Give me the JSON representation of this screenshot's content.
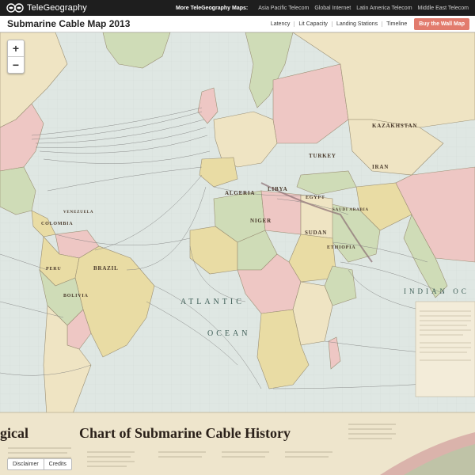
{
  "topbar": {
    "brand": "TeleGeography",
    "more_label": "More TeleGeography Maps:",
    "links": [
      "Asia Pacific Telecom",
      "Global Internet",
      "Latin America Telecom",
      "Middle East Telecom"
    ]
  },
  "titlebar": {
    "title": "Submarine Cable Map 2013",
    "nav": [
      "Latency",
      "Lit Capacity",
      "Landing Stations",
      "Timeline"
    ],
    "buy": "Buy the Wall Map"
  },
  "zoom": {
    "in": "+",
    "out": "−"
  },
  "map": {
    "oceans": {
      "atlantic": "ATLANTIC",
      "ocean": "OCEAN",
      "indian": "INDIAN OC"
    },
    "countries": {
      "algeria": "ALGERIA",
      "libya": "LIBYA",
      "egypt": "EGYPT",
      "niger": "NIGER",
      "sudan": "SUDAN",
      "ethiopia": "ETHIOPIA",
      "brazil": "BRAZIL",
      "colombia": "COLOMBIA",
      "bolivia": "BOLIVIA",
      "kazakhstan": "KAZAKHSTAN",
      "turkey": "TURKEY",
      "iran": "IRAN",
      "saudi": "SAUDI ARABIA",
      "peru": "PERU",
      "venezuela": "VENEZUELA"
    },
    "chart_title_left": "gical",
    "chart_title_main": "Chart of Submarine Cable History"
  },
  "bottom": {
    "disclaimer": "Disclaimer",
    "credits": "Credits"
  },
  "colors": {
    "ocean": "#dfe7e3",
    "land_cream": "#efe4c3",
    "land_pink": "#eec7c4",
    "land_green": "#cfdcb7",
    "land_yellow": "#e9dca4",
    "cable": "#7c7c7c",
    "buy": "#e27b6d"
  }
}
